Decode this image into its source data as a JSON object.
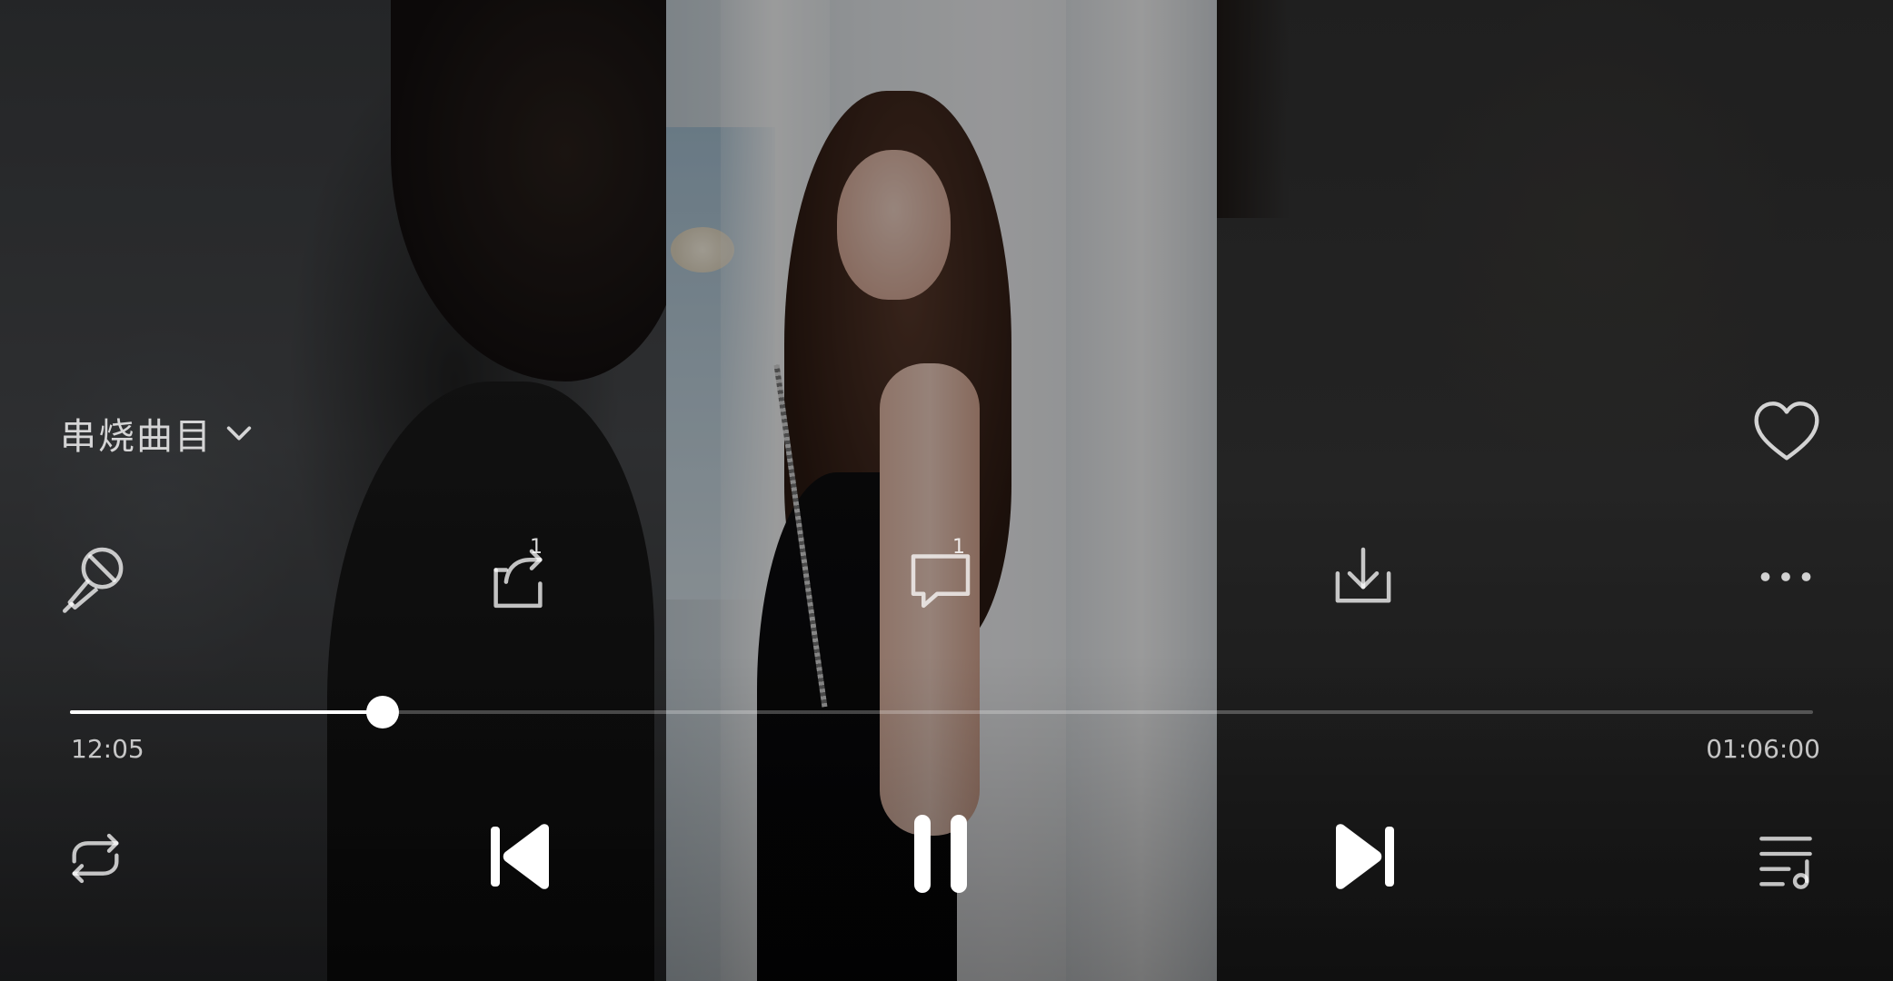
{
  "player": {
    "playlist_label": "串烧曲目",
    "elapsed_time": "12:05",
    "total_time": "01:06:00",
    "progress_fraction": 0.1795
  },
  "actions": {
    "lyrics_badge": "",
    "share_badge": "1",
    "comment_badge": "1"
  },
  "colors": {
    "accent": "#ffffff",
    "icon_dim": "rgba(255,255,255,0.75)"
  },
  "icons": {
    "playlist_chevron": "chevron-down-icon",
    "favorite": "heart-icon",
    "karaoke": "microphone-off-icon",
    "share": "share-box-icon",
    "comment": "comment-bubble-icon",
    "download": "download-icon",
    "more": "more-dots-icon",
    "repeat": "repeat-icon",
    "previous": "skip-previous-icon",
    "pause": "pause-icon",
    "next": "skip-next-icon",
    "queue": "playlist-queue-icon"
  }
}
